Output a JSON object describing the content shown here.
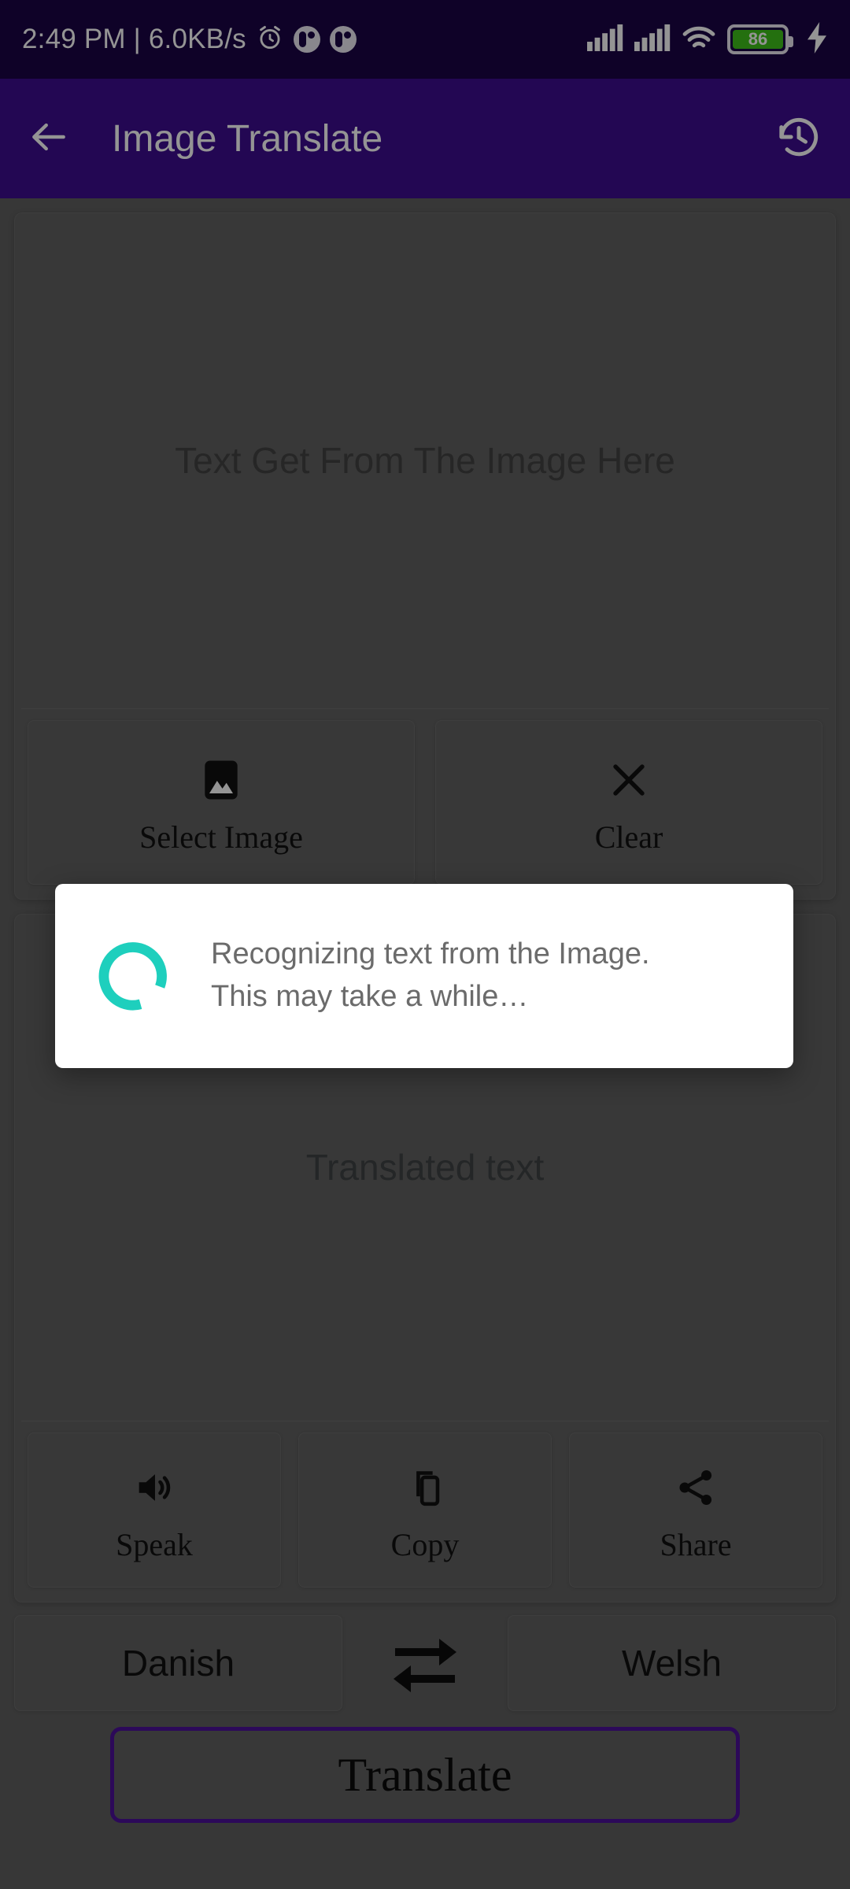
{
  "status_bar": {
    "time_and_speed": "2:49 PM | 6.0KB/s",
    "icons": [
      "alarm-icon",
      "app-notification-icon",
      "app-notification-icon",
      "signal-icon",
      "signal-icon",
      "wifi-icon",
      "battery-icon",
      "charging-bolt-icon"
    ],
    "battery_level": "86",
    "battery_color": "#3ec21a",
    "background": "#1a0546"
  },
  "app_bar": {
    "back_icon": "back-arrow-icon",
    "title": "Image Translate",
    "history_icon": "history-clock-icon",
    "background": "#3d0d8f"
  },
  "source_card": {
    "placeholder": "Text Get From The Image Here",
    "actions": [
      {
        "label": "Select Image",
        "icon": "image-icon"
      },
      {
        "label": "Clear",
        "icon": "close-x-icon"
      }
    ]
  },
  "target_card": {
    "placeholder": "Translated text",
    "actions": [
      {
        "label": "Speak",
        "icon": "speaker-volume-icon"
      },
      {
        "label": "Copy",
        "icon": "copy-icon"
      },
      {
        "label": "Share",
        "icon": "share-icon"
      }
    ]
  },
  "language_selector": {
    "source_language": "Danish",
    "target_language": "Welsh",
    "swap_icon": "swap-arrows-icon"
  },
  "translate_button": {
    "label": "Translate",
    "border_color": "#4c1099"
  },
  "dialog": {
    "message": "Recognizing text from the Image.\nThis may take a while…",
    "spinner_icon": "loading-spinner-icon",
    "spinner_color": "#1ecfbd",
    "background": "#ffffff"
  }
}
